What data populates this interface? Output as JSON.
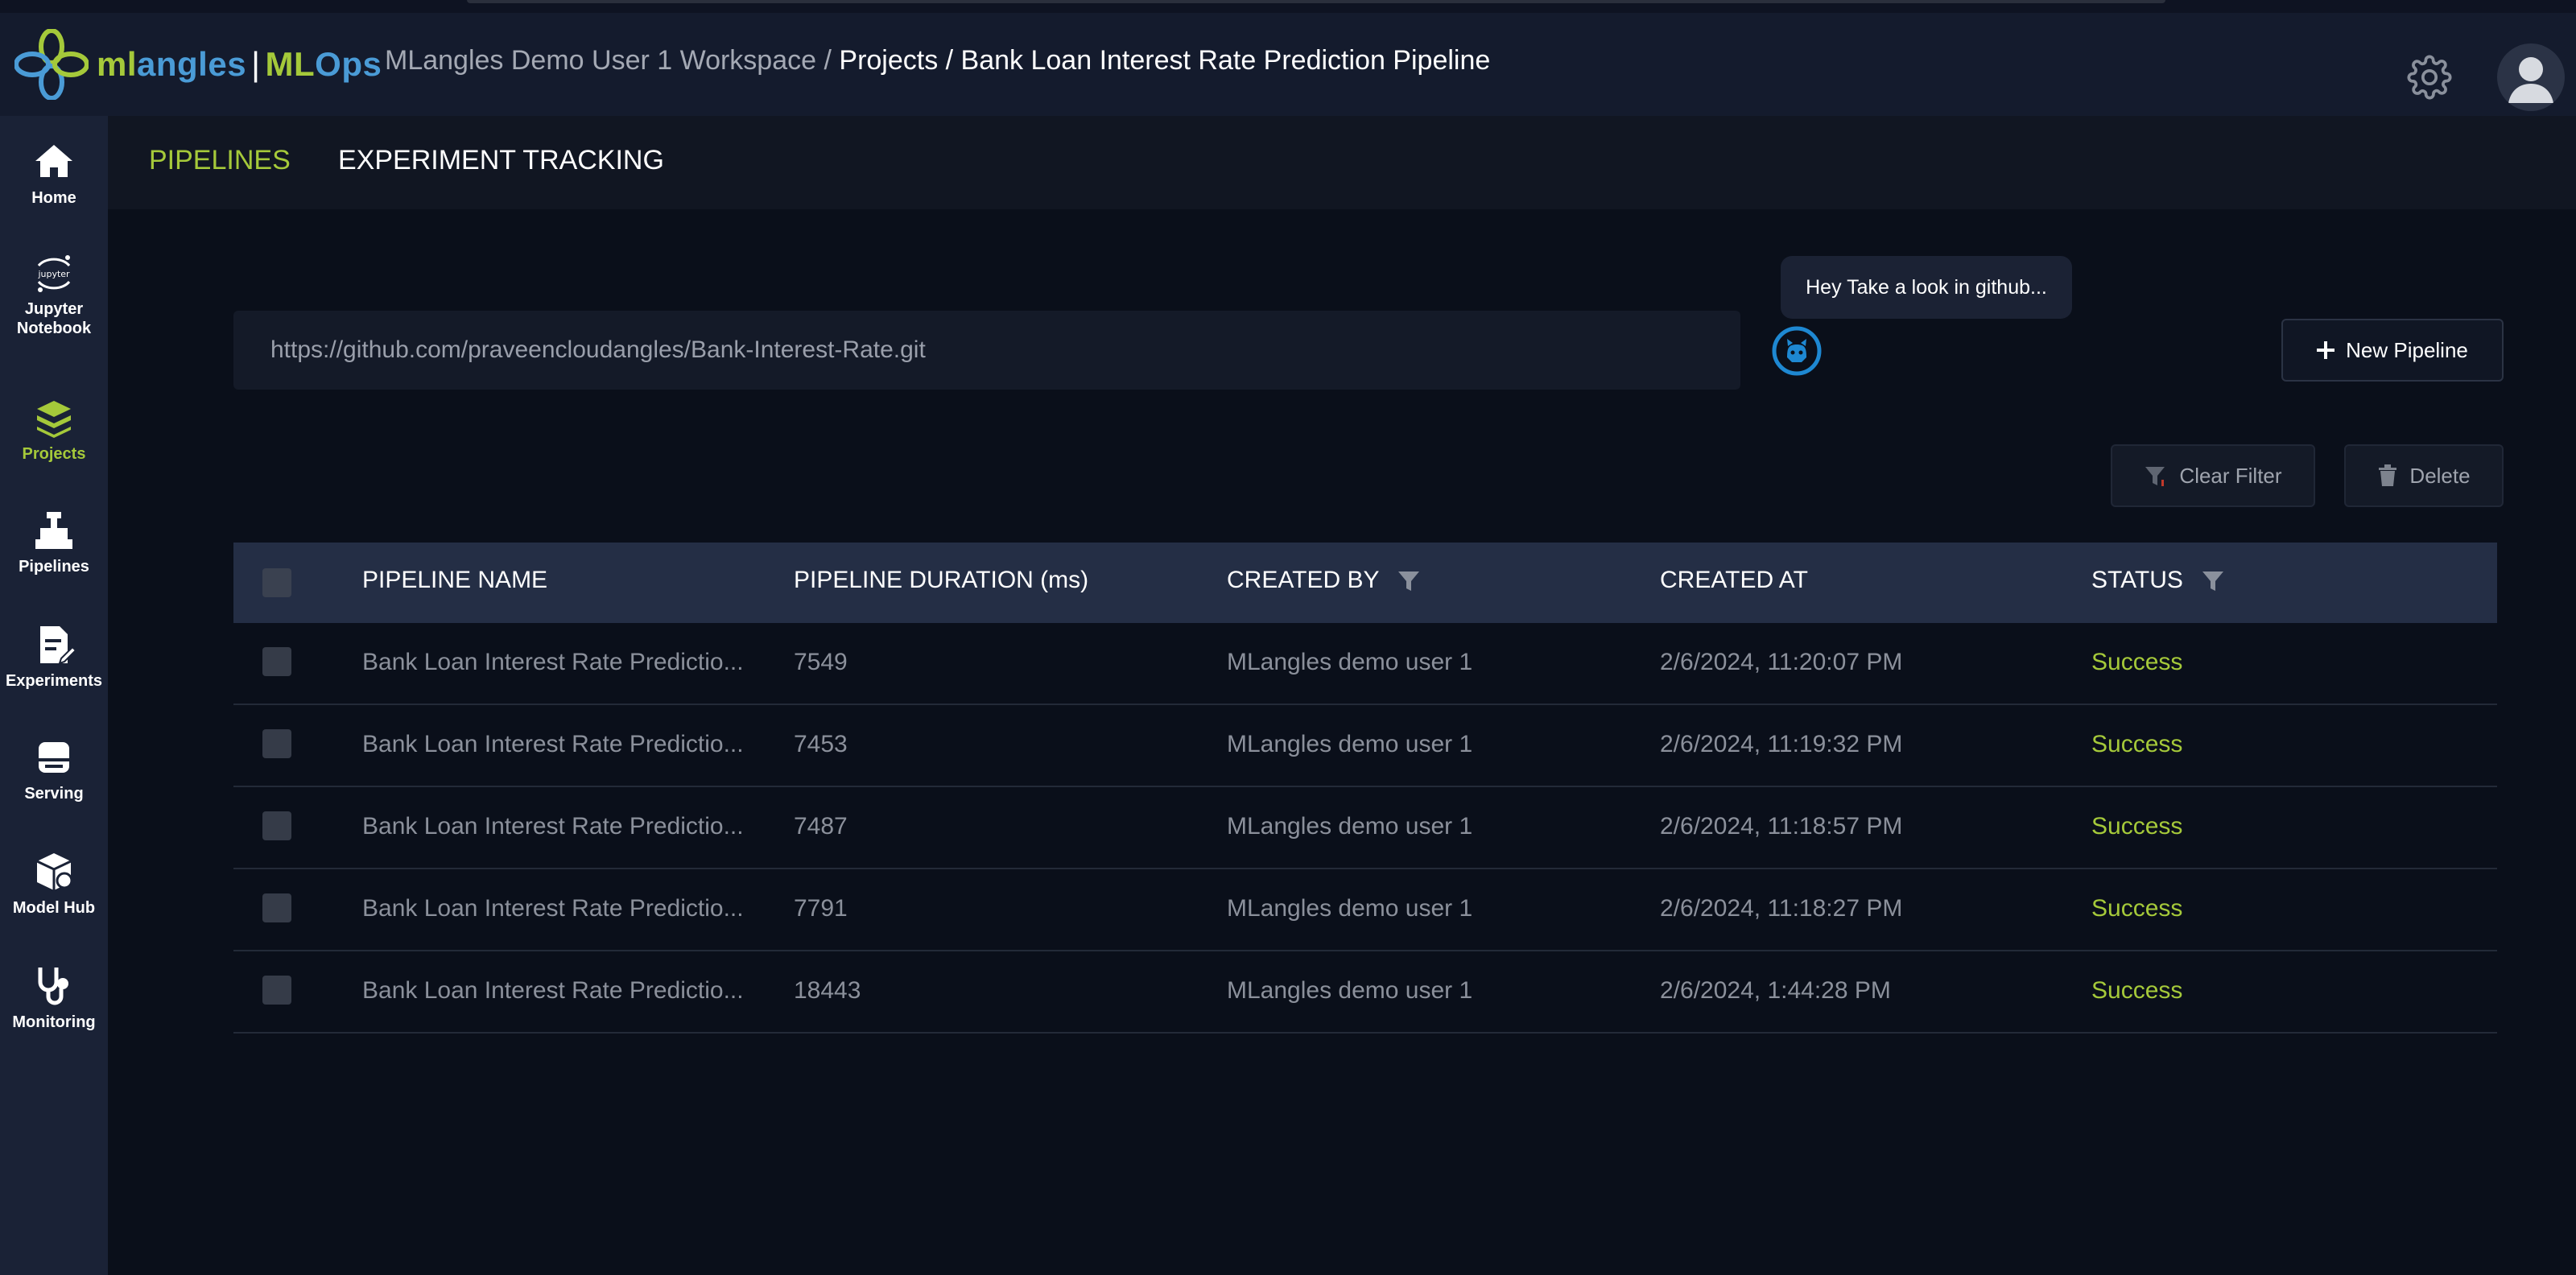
{
  "header": {
    "logo": {
      "ml": "ml",
      "angles": "angles",
      "bar": "|",
      "ML": "ML",
      "Ops": "Ops"
    },
    "breadcrumb": {
      "workspace": "MLangles Demo User 1 Workspace /",
      "rest": "Projects / Bank Loan Interest Rate Prediction Pipeline"
    }
  },
  "sidebar": {
    "items": [
      {
        "label": "Home",
        "icon": "home-icon"
      },
      {
        "label_line1": "Jupyter",
        "label_line2": "Notebook",
        "icon": "jupyter-icon",
        "icon_text": "jupyter"
      },
      {
        "label": "Projects",
        "icon": "layers-icon",
        "active": true
      },
      {
        "label": "Pipelines",
        "icon": "pipeline-icon"
      },
      {
        "label": "Experiments",
        "icon": "experiment-icon"
      },
      {
        "label": "Serving",
        "icon": "serving-icon"
      },
      {
        "label": "Model Hub",
        "icon": "model-hub-icon"
      },
      {
        "label": "Monitoring",
        "icon": "stethoscope-icon"
      }
    ]
  },
  "tabs": [
    {
      "label": "PIPELINES",
      "active": true
    },
    {
      "label": "EXPERIMENT TRACKING",
      "active": false
    }
  ],
  "repo": {
    "url_value": "https://github.com/praveencloudangles/Bank-Interest-Rate.git",
    "tooltip": "Hey Take a look in github..."
  },
  "buttons": {
    "new_pipeline": "New Pipeline",
    "clear_filter": "Clear Filter",
    "delete": "Delete"
  },
  "table": {
    "columns": [
      "PIPELINE NAME",
      "PIPELINE DURATION (ms)",
      "CREATED BY",
      "CREATED AT",
      "STATUS"
    ],
    "rows": [
      {
        "name": "Bank Loan Interest Rate Predictio...",
        "duration": "7549",
        "created_by": "MLangles demo user 1",
        "created_at": "2/6/2024, 11:20:07 PM",
        "status": "Success"
      },
      {
        "name": "Bank Loan Interest Rate Predictio...",
        "duration": "7453",
        "created_by": "MLangles demo user 1",
        "created_at": "2/6/2024, 11:19:32 PM",
        "status": "Success"
      },
      {
        "name": "Bank Loan Interest Rate Predictio...",
        "duration": "7487",
        "created_by": "MLangles demo user 1",
        "created_at": "2/6/2024, 11:18:57 PM",
        "status": "Success"
      },
      {
        "name": "Bank Loan Interest Rate Predictio...",
        "duration": "7791",
        "created_by": "MLangles demo user 1",
        "created_at": "2/6/2024, 11:18:27 PM",
        "status": "Success"
      },
      {
        "name": "Bank Loan Interest Rate Predictio...",
        "duration": "18443",
        "created_by": "MLangles demo user 1",
        "created_at": "2/6/2024, 1:44:28 PM",
        "status": "Success"
      }
    ]
  },
  "colors": {
    "accent_green": "#a5c93a",
    "accent_blue": "#4a9bd6",
    "sidebar_bg": "#1a2236",
    "header_bg": "#141b2d",
    "table_header_bg": "#242e45"
  }
}
